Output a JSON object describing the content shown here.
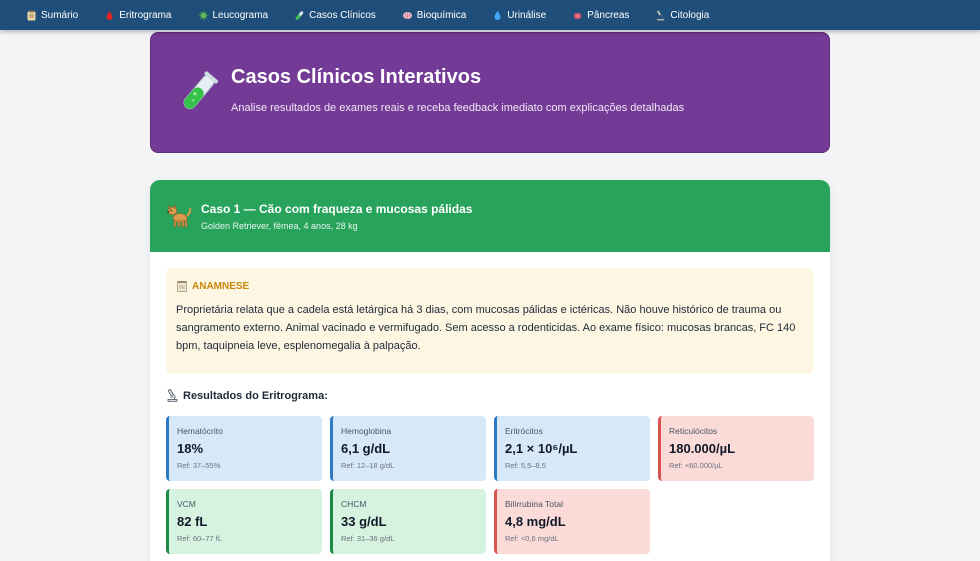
{
  "nav": {
    "items": [
      {
        "label": "Sumário",
        "icon": "clipboard-icon"
      },
      {
        "label": "Eritrograma",
        "icon": "blood-drop-icon"
      },
      {
        "label": "Leucograma",
        "icon": "microbe-icon"
      },
      {
        "label": "Casos Clínicos",
        "icon": "test-tube-icon"
      },
      {
        "label": "Bioquímica",
        "icon": "brain-icon"
      },
      {
        "label": "Urinálise",
        "icon": "water-drop-icon"
      },
      {
        "label": "Pâncreas",
        "icon": "organ-icon"
      },
      {
        "label": "Citologia",
        "icon": "microscope-icon"
      }
    ]
  },
  "hero": {
    "title": "Casos Clínicos Interativos",
    "subtitle": "Analise resultados de exames reais e receba feedback imediato com explicações detalhadas",
    "icon": "test-tube-icon"
  },
  "case": {
    "title": "Caso 1 — Cão com fraqueza e mucosas pálidas",
    "subtitle": "Golden Retriever, fêmea, 4 anos, 28 kg",
    "icon": "dog-icon",
    "anamnese": {
      "label": "ANAMNESE",
      "text": "Proprietária relata que a cadela está letárgica há 3 dias, com mucosas pálidas e ictéricas. Não houve histórico de trauma ou sangramento externo. Animal vacinado e vermifugado. Sem acesso a rodenticidas. Ao exame físico: mucosas brancas, FC 140 bpm, taquipneia leve, esplenomegalia à palpação."
    },
    "results_title": "Resultados do Eritrograma:",
    "results": [
      {
        "label": "Hematócrito",
        "value": "18%",
        "ref": "Ref: 37–55%",
        "status": "blue"
      },
      {
        "label": "Hemoglobina",
        "value": "6,1 g/dL",
        "ref": "Ref: 12–18 g/dL",
        "status": "blue"
      },
      {
        "label": "Eritrócitos",
        "value": "2,1 × 10⁶/µL",
        "ref": "Ref: 5,5–8,5",
        "status": "blue"
      },
      {
        "label": "Reticulócitos",
        "value": "180.000/µL",
        "ref": "Ref: <60.000/µL",
        "status": "red"
      },
      {
        "label": "VCM",
        "value": "82 fL",
        "ref": "Ref: 60–77 fL",
        "status": "green"
      },
      {
        "label": "CHCM",
        "value": "33 g/dL",
        "ref": "Ref: 31–36 g/dL",
        "status": "green"
      },
      {
        "label": "Bilirrubina Total",
        "value": "4,8 mg/dL",
        "ref": "Ref: <0,6 mg/dL",
        "status": "red"
      }
    ]
  },
  "colors": {
    "nav_bg": "#1e4e79",
    "hero_bg": "#733b95",
    "case_header_bg": "#27a35c",
    "anamnese_bg": "#fdf6e3",
    "anamnese_label": "#c8860a"
  }
}
